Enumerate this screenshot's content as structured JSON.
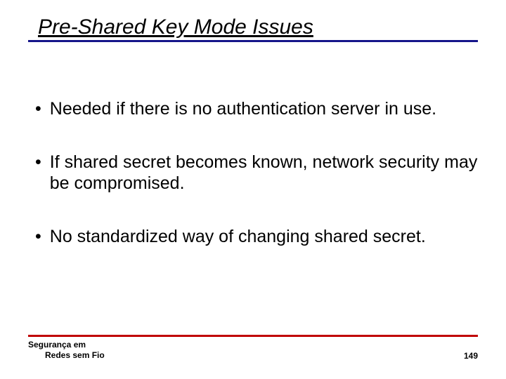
{
  "title": "Pre-Shared Key Mode Issues",
  "bullets": [
    "Needed if there is no authentication server in use.",
    "If shared secret becomes known, network security may be compromised.",
    "No standardized way of changing shared secret."
  ],
  "footer": {
    "line1": "Segurança em",
    "line2": "Redes sem Fio",
    "page": "149"
  },
  "colors": {
    "title_rule": "#15158a",
    "footer_rule": "#c00000"
  }
}
